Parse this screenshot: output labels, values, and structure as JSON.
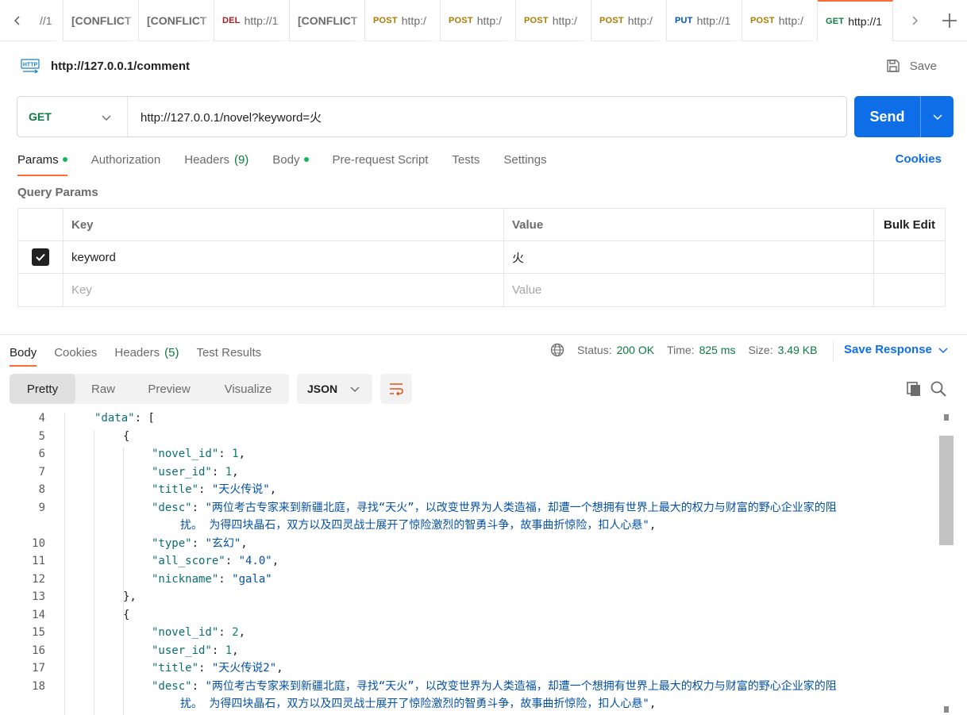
{
  "tabbar": {
    "tabs": [
      {
        "method": "",
        "text": "//1",
        "conflict": false,
        "method_color": ""
      },
      {
        "method": "",
        "text": "[CONFLICT",
        "conflict": true,
        "method_color": ""
      },
      {
        "method": "",
        "text": "[CONFLICT",
        "conflict": true,
        "method_color": ""
      },
      {
        "method": "DEL",
        "text": "http://1",
        "conflict": false,
        "method_color": "#a61d20"
      },
      {
        "method": "",
        "text": "[CONFLICT",
        "conflict": true,
        "method_color": ""
      },
      {
        "method": "POST",
        "text": "http:/",
        "conflict": false,
        "method_color": "#ad7a03"
      },
      {
        "method": "POST",
        "text": "http:/",
        "conflict": false,
        "method_color": "#ad7a03"
      },
      {
        "method": "POST",
        "text": "http:/",
        "conflict": false,
        "method_color": "#ad7a03"
      },
      {
        "method": "POST",
        "text": "http:/",
        "conflict": false,
        "method_color": "#ad7a03"
      },
      {
        "method": "PUT",
        "text": "http://1",
        "conflict": false,
        "method_color": "#0053b8"
      },
      {
        "method": "POST",
        "text": "http:/",
        "conflict": false,
        "method_color": "#ad7a03"
      },
      {
        "method": "GET",
        "text": "http://1",
        "conflict": false,
        "method_color": "#0b7a40",
        "active": true
      }
    ]
  },
  "request": {
    "title": "http://127.0.0.1/comment",
    "save_label": "Save",
    "method": "GET",
    "url": "http://127.0.0.1/novel?keyword=火",
    "send_label": "Send"
  },
  "request_tabs": [
    {
      "label": "Params",
      "dot": true,
      "count": "",
      "active": true
    },
    {
      "label": "Authorization",
      "dot": false,
      "count": "",
      "active": false
    },
    {
      "label": "Headers",
      "dot": false,
      "count": "(9)",
      "active": false
    },
    {
      "label": "Body",
      "dot": true,
      "count": "",
      "active": false
    },
    {
      "label": "Pre-request Script",
      "dot": false,
      "count": "",
      "active": false
    },
    {
      "label": "Tests",
      "dot": false,
      "count": "",
      "active": false
    },
    {
      "label": "Settings",
      "dot": false,
      "count": "",
      "active": false
    }
  ],
  "cookies_label": "Cookies",
  "query_params": {
    "label": "Query Params",
    "headers": {
      "key": "Key",
      "value": "Value",
      "bulk": "Bulk Edit"
    },
    "rows": [
      {
        "checked": true,
        "key": "keyword",
        "value": "火"
      }
    ],
    "placeholder": {
      "key": "Key",
      "value": "Value"
    }
  },
  "response": {
    "tabs": [
      {
        "label": "Body",
        "count": "",
        "active": true
      },
      {
        "label": "Cookies",
        "count": "",
        "active": false
      },
      {
        "label": "Headers",
        "count": "(5)",
        "active": false
      },
      {
        "label": "Test Results",
        "count": "",
        "active": false
      }
    ],
    "status_label": "Status:",
    "status_value": "200 OK",
    "time_label": "Time:",
    "time_value": "825 ms",
    "size_label": "Size:",
    "size_value": "3.49 KB",
    "save_response": "Save Response",
    "formats": [
      "Pretty",
      "Raw",
      "Preview",
      "Visualize"
    ],
    "active_format": "Pretty",
    "language": "JSON"
  },
  "code_lines": [
    {
      "n": "4",
      "indent": 0,
      "tokens": [
        [
          "k",
          "\"data\""
        ],
        [
          "p",
          ": ["
        ]
      ]
    },
    {
      "n": "5",
      "indent": 1,
      "tokens": [
        [
          "p",
          "{"
        ]
      ]
    },
    {
      "n": "6",
      "indent": 2,
      "tokens": [
        [
          "k",
          "\"novel_id\""
        ],
        [
          "p",
          ": "
        ],
        [
          "n",
          "1"
        ],
        [
          "p",
          ","
        ]
      ]
    },
    {
      "n": "7",
      "indent": 2,
      "tokens": [
        [
          "k",
          "\"user_id\""
        ],
        [
          "p",
          ": "
        ],
        [
          "n",
          "1"
        ],
        [
          "p",
          ","
        ]
      ]
    },
    {
      "n": "8",
      "indent": 2,
      "tokens": [
        [
          "k",
          "\"title\""
        ],
        [
          "p",
          ": "
        ],
        [
          "s",
          "\"天火传说\""
        ],
        [
          "p",
          ","
        ]
      ]
    },
    {
      "n": "9",
      "indent": 2,
      "tokens": [
        [
          "k",
          "\"desc\""
        ],
        [
          "p",
          ": "
        ],
        [
          "s",
          "\"两位考古专家来到新疆北庭，寻找“天火”，以改变世界为人类造福，却遭一个想拥有世界上最大的权力与财富的野心企业家的阻"
        ]
      ]
    },
    {
      "n": "",
      "indent": 3,
      "tokens": [
        [
          "s",
          "扰。 为得四块晶石，双方以及四灵战士展开了惊险激烈的智勇斗争，故事曲折惊险，扣人心悬\""
        ],
        [
          "p",
          ","
        ]
      ]
    },
    {
      "n": "10",
      "indent": 2,
      "tokens": [
        [
          "k",
          "\"type\""
        ],
        [
          "p",
          ": "
        ],
        [
          "s",
          "\"玄幻\""
        ],
        [
          "p",
          ","
        ]
      ]
    },
    {
      "n": "11",
      "indent": 2,
      "tokens": [
        [
          "k",
          "\"all_score\""
        ],
        [
          "p",
          ": "
        ],
        [
          "s",
          "\"4.0\""
        ],
        [
          "p",
          ","
        ]
      ]
    },
    {
      "n": "12",
      "indent": 2,
      "tokens": [
        [
          "k",
          "\"nickname\""
        ],
        [
          "p",
          ": "
        ],
        [
          "s",
          "\"gala\""
        ]
      ]
    },
    {
      "n": "13",
      "indent": 1,
      "tokens": [
        [
          "p",
          "},"
        ]
      ]
    },
    {
      "n": "14",
      "indent": 1,
      "tokens": [
        [
          "p",
          "{"
        ]
      ]
    },
    {
      "n": "15",
      "indent": 2,
      "tokens": [
        [
          "k",
          "\"novel_id\""
        ],
        [
          "p",
          ": "
        ],
        [
          "n",
          "2"
        ],
        [
          "p",
          ","
        ]
      ]
    },
    {
      "n": "16",
      "indent": 2,
      "tokens": [
        [
          "k",
          "\"user_id\""
        ],
        [
          "p",
          ": "
        ],
        [
          "n",
          "1"
        ],
        [
          "p",
          ","
        ]
      ]
    },
    {
      "n": "17",
      "indent": 2,
      "tokens": [
        [
          "k",
          "\"title\""
        ],
        [
          "p",
          ": "
        ],
        [
          "s",
          "\"天火传说2\""
        ],
        [
          "p",
          ","
        ]
      ]
    },
    {
      "n": "18",
      "indent": 2,
      "tokens": [
        [
          "k",
          "\"desc\""
        ],
        [
          "p",
          ": "
        ],
        [
          "s",
          "\"两位考古专家来到新疆北庭，寻找“天火”，以改变世界为人类造福，却遭一个想拥有世界上最大的权力与财富的野心企业家的阻"
        ]
      ]
    },
    {
      "n": "",
      "indent": 3,
      "tokens": [
        [
          "s",
          "扰。 为得四块晶石，双方以及四灵战士展开了惊险激烈的智勇斗争，故事曲折惊险，扣人心悬\""
        ],
        [
          "p",
          ","
        ]
      ]
    }
  ],
  "colors": {
    "accent": "#ff6c37",
    "primary": "#0d6ee8",
    "success": "#0b7a40"
  }
}
